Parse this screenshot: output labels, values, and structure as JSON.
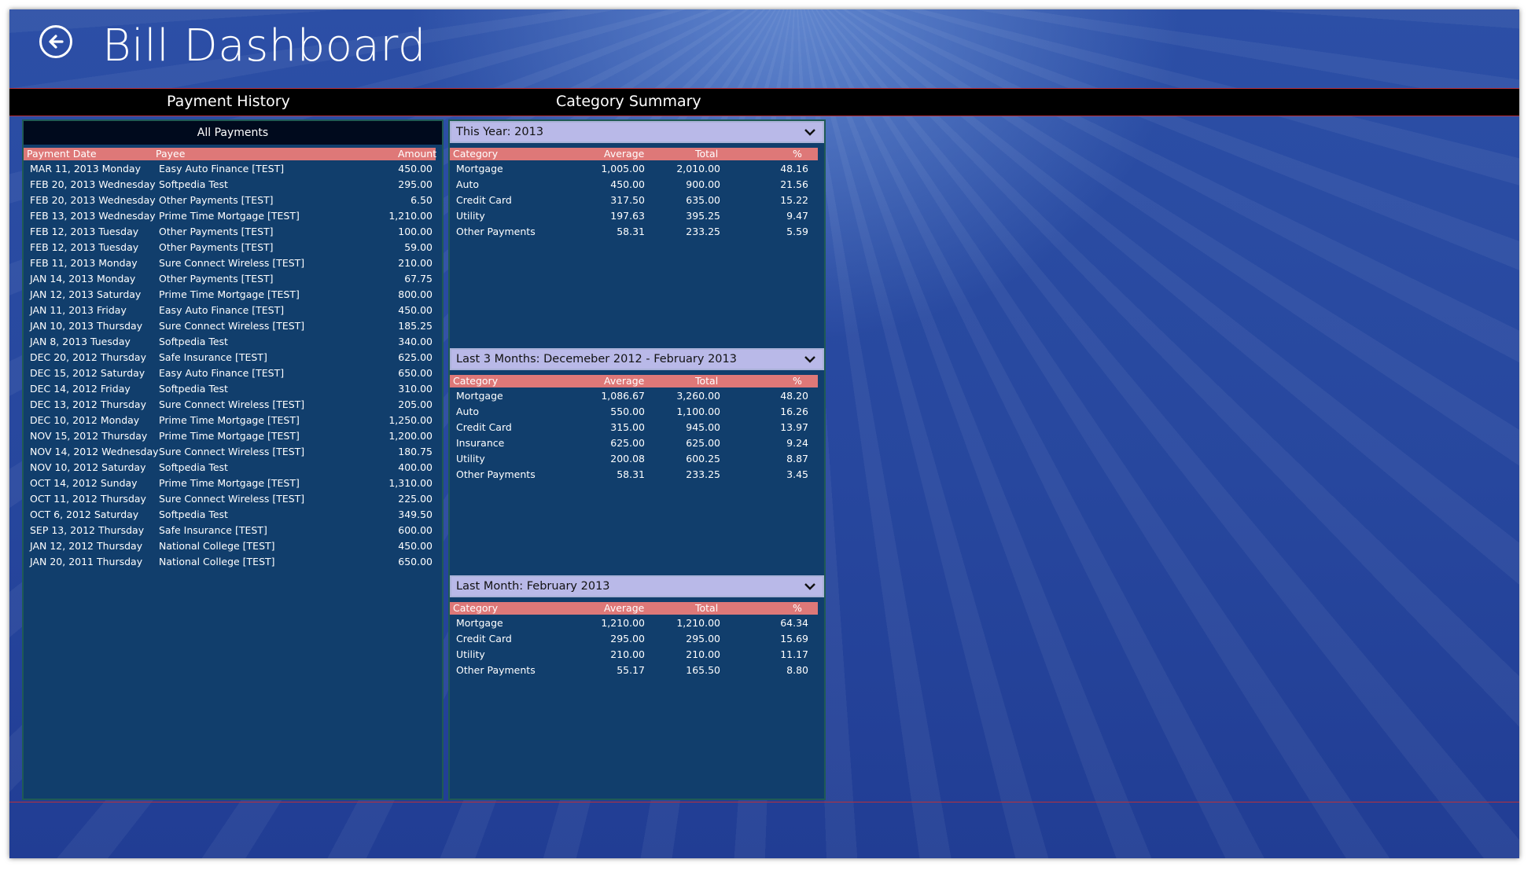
{
  "app": {
    "title": "Bill Dashboard"
  },
  "header": {
    "payment_history": "Payment History",
    "category_summary": "Category Summary"
  },
  "payments": {
    "title": "All Payments",
    "columns": {
      "date": "Payment Date",
      "payee": "Payee",
      "amount": "Amount"
    },
    "rows": [
      {
        "date": "MAR 11, 2013 Monday",
        "payee": "Easy Auto Finance [TEST]",
        "amount": "450.00"
      },
      {
        "date": "FEB 20, 2013 Wednesday",
        "payee": "Softpedia Test",
        "amount": "295.00"
      },
      {
        "date": "FEB 20, 2013 Wednesday",
        "payee": "Other Payments [TEST]",
        "amount": "6.50"
      },
      {
        "date": "FEB 13, 2013 Wednesday",
        "payee": "Prime Time Mortgage [TEST]",
        "amount": "1,210.00"
      },
      {
        "date": "FEB 12, 2013 Tuesday",
        "payee": "Other Payments [TEST]",
        "amount": "100.00"
      },
      {
        "date": "FEB 12, 2013 Tuesday",
        "payee": "Other Payments [TEST]",
        "amount": "59.00"
      },
      {
        "date": "FEB 11, 2013 Monday",
        "payee": "Sure Connect Wireless [TEST]",
        "amount": "210.00"
      },
      {
        "date": "JAN 14, 2013 Monday",
        "payee": "Other Payments [TEST]",
        "amount": "67.75"
      },
      {
        "date": "JAN 12, 2013 Saturday",
        "payee": "Prime Time Mortgage [TEST]",
        "amount": "800.00"
      },
      {
        "date": "JAN 11, 2013 Friday",
        "payee": "Easy Auto Finance [TEST]",
        "amount": "450.00"
      },
      {
        "date": "JAN 10, 2013 Thursday",
        "payee": "Sure Connect Wireless [TEST]",
        "amount": "185.25"
      },
      {
        "date": "JAN 8, 2013 Tuesday",
        "payee": "Softpedia Test",
        "amount": "340.00"
      },
      {
        "date": "DEC 20, 2012 Thursday",
        "payee": "Safe Insurance [TEST]",
        "amount": "625.00"
      },
      {
        "date": "DEC 15, 2012 Saturday",
        "payee": "Easy Auto Finance [TEST]",
        "amount": "650.00"
      },
      {
        "date": "DEC 14, 2012 Friday",
        "payee": "Softpedia Test",
        "amount": "310.00"
      },
      {
        "date": "DEC 13, 2012 Thursday",
        "payee": "Sure Connect Wireless [TEST]",
        "amount": "205.00"
      },
      {
        "date": "DEC 10, 2012 Monday",
        "payee": "Prime Time Mortgage [TEST]",
        "amount": "1,250.00"
      },
      {
        "date": "NOV 15, 2012 Thursday",
        "payee": "Prime Time Mortgage [TEST]",
        "amount": "1,200.00"
      },
      {
        "date": "NOV 14, 2012 Wednesday",
        "payee": "Sure Connect Wireless [TEST]",
        "amount": "180.75"
      },
      {
        "date": "NOV 10, 2012 Saturday",
        "payee": "Softpedia Test",
        "amount": "400.00"
      },
      {
        "date": "OCT 14, 2012 Sunday",
        "payee": "Prime Time Mortgage [TEST]",
        "amount": "1,310.00"
      },
      {
        "date": "OCT 11, 2012 Thursday",
        "payee": "Sure Connect Wireless [TEST]",
        "amount": "225.00"
      },
      {
        "date": "OCT 6, 2012 Saturday",
        "payee": "Softpedia Test",
        "amount": "349.50"
      },
      {
        "date": "SEP 13, 2012 Thursday",
        "payee": "Safe Insurance [TEST]",
        "amount": "600.00"
      },
      {
        "date": "JAN 12, 2012 Thursday",
        "payee": "National College [TEST]",
        "amount": "450.00"
      },
      {
        "date": "JAN 20, 2011 Thursday",
        "payee": "National College [TEST]",
        "amount": "650.00"
      }
    ]
  },
  "summary": {
    "columns": {
      "category": "Category",
      "average": "Average",
      "total": "Total",
      "percent": "%"
    },
    "sections": [
      {
        "label": "This Year: 2013",
        "rows": [
          {
            "category": "Mortgage",
            "average": "1,005.00",
            "total": "2,010.00",
            "percent": "48.16"
          },
          {
            "category": "Auto",
            "average": "450.00",
            "total": "900.00",
            "percent": "21.56"
          },
          {
            "category": "Credit Card",
            "average": "317.50",
            "total": "635.00",
            "percent": "15.22"
          },
          {
            "category": "Utility",
            "average": "197.63",
            "total": "395.25",
            "percent": "9.47"
          },
          {
            "category": "Other Payments",
            "average": "58.31",
            "total": "233.25",
            "percent": "5.59"
          }
        ]
      },
      {
        "label": "Last 3 Months: Decemeber 2012 - February 2013",
        "rows": [
          {
            "category": "Mortgage",
            "average": "1,086.67",
            "total": "3,260.00",
            "percent": "48.20"
          },
          {
            "category": "Auto",
            "average": "550.00",
            "total": "1,100.00",
            "percent": "16.26"
          },
          {
            "category": "Credit Card",
            "average": "315.00",
            "total": "945.00",
            "percent": "13.97"
          },
          {
            "category": "Insurance",
            "average": "625.00",
            "total": "625.00",
            "percent": "9.24"
          },
          {
            "category": "Utility",
            "average": "200.08",
            "total": "600.25",
            "percent": "8.87"
          },
          {
            "category": "Other Payments",
            "average": "58.31",
            "total": "233.25",
            "percent": "3.45"
          }
        ]
      },
      {
        "label": "Last Month: February 2013",
        "rows": [
          {
            "category": "Mortgage",
            "average": "1,210.00",
            "total": "1,210.00",
            "percent": "64.34"
          },
          {
            "category": "Credit Card",
            "average": "295.00",
            "total": "295.00",
            "percent": "15.69"
          },
          {
            "category": "Utility",
            "average": "210.00",
            "total": "210.00",
            "percent": "11.17"
          },
          {
            "category": "Other Payments",
            "average": "55.17",
            "total": "165.50",
            "percent": "8.80"
          }
        ]
      }
    ]
  },
  "colors": {
    "background": "#27479e",
    "header_bar": "#000000",
    "accent_line": "#b8303a",
    "column_header": "#de7878",
    "panel": "#113e6c",
    "dropdown": "#b9b9e8"
  },
  "icons": {
    "back": "back-arrow-icon",
    "dropdown": "chevron-down-icon"
  }
}
